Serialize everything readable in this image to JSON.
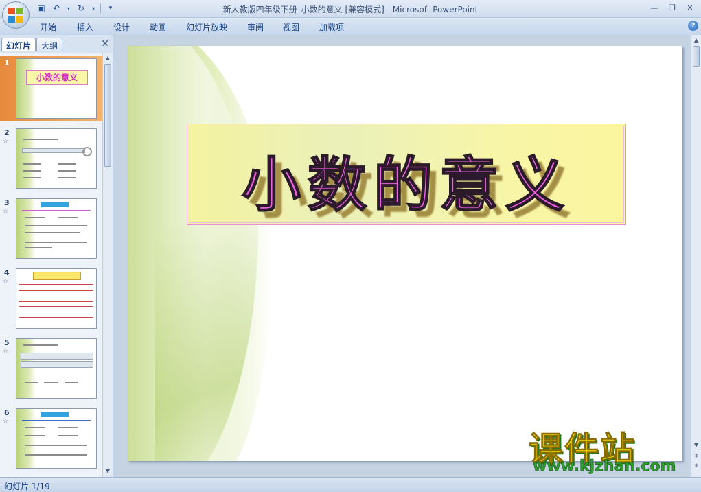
{
  "window": {
    "title": "新人教版四年级下册_小数的意义 [兼容模式] - Microsoft PowerPoint"
  },
  "quick_access": [
    "save-icon",
    "undo-icon",
    "redo-icon",
    "customize-icon"
  ],
  "ribbon": {
    "tabs": [
      "开始",
      "插入",
      "设计",
      "动画",
      "幻灯片放映",
      "审阅",
      "视图",
      "加载项"
    ]
  },
  "left_pane": {
    "tabs": [
      "幻灯片",
      "大纲"
    ],
    "slides": [
      {
        "num": "1",
        "title": "小数的意义",
        "selected": true
      },
      {
        "num": "2"
      },
      {
        "num": "3"
      },
      {
        "num": "4"
      },
      {
        "num": "5"
      },
      {
        "num": "6"
      }
    ]
  },
  "slide": {
    "title": "小数的意义"
  },
  "status": {
    "slide_info": "幻灯片 1/19"
  },
  "watermark": {
    "main": "课件站",
    "url": "www.kjzhan.com"
  },
  "colors": {
    "title_fill": "#ef5fe3",
    "title_box": "#f6f3a0",
    "swoosh": "#b6cf72",
    "selected_thumb": "#e68a3c"
  }
}
